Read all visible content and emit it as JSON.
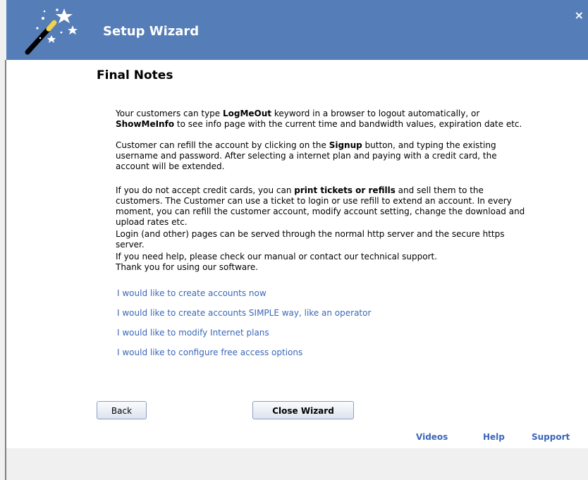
{
  "window": {
    "title": "Setup Wizard",
    "close_glyph": "×",
    "header_icon": "magic-wand-icon",
    "accent_color": "#557eb8"
  },
  "page": {
    "heading": "Final Notes",
    "p1": {
      "t1": "Your customers can type ",
      "b1": "LogMeOut",
      "t2": " keyword in a browser to logout automatically, or",
      "b2": "ShowMeInfo",
      "t3": " to see info page with the current time and bandwidth values, expiration date etc."
    },
    "p2": {
      "t1": "Customer can refill the account by clicking on the ",
      "b1": "Signup",
      "t2": " button, and typing the existing username and password. After selecting a internet plan and paying with a credit card, the account will be extended."
    },
    "p3": {
      "t1": "If you do not accept credit cards, you can ",
      "b1": "print tickets or refills",
      "t2": " and sell them to the customers. The Customer can use a ticket to login or use refill to extend an account. In every moment, you can refill the customer account, modify account setting, change the download and upload rates etc."
    },
    "p4": "Login (and other) pages can be served through the normal http server and the secure https server.",
    "p5": {
      "line1": "If you need help, please check our manual or contact our technical support.",
      "line2": "Thank you for using our software."
    },
    "links": [
      "I would like to create accounts now",
      "I would like to create accounts SIMPLE way, like an operator",
      "I would like to modify Internet plans",
      "I would like to configure free access options"
    ]
  },
  "buttons": {
    "back": "Back",
    "close_wizard": "Close Wizard"
  },
  "footer": {
    "videos": "Videos",
    "help": "Help",
    "support": "Support"
  }
}
